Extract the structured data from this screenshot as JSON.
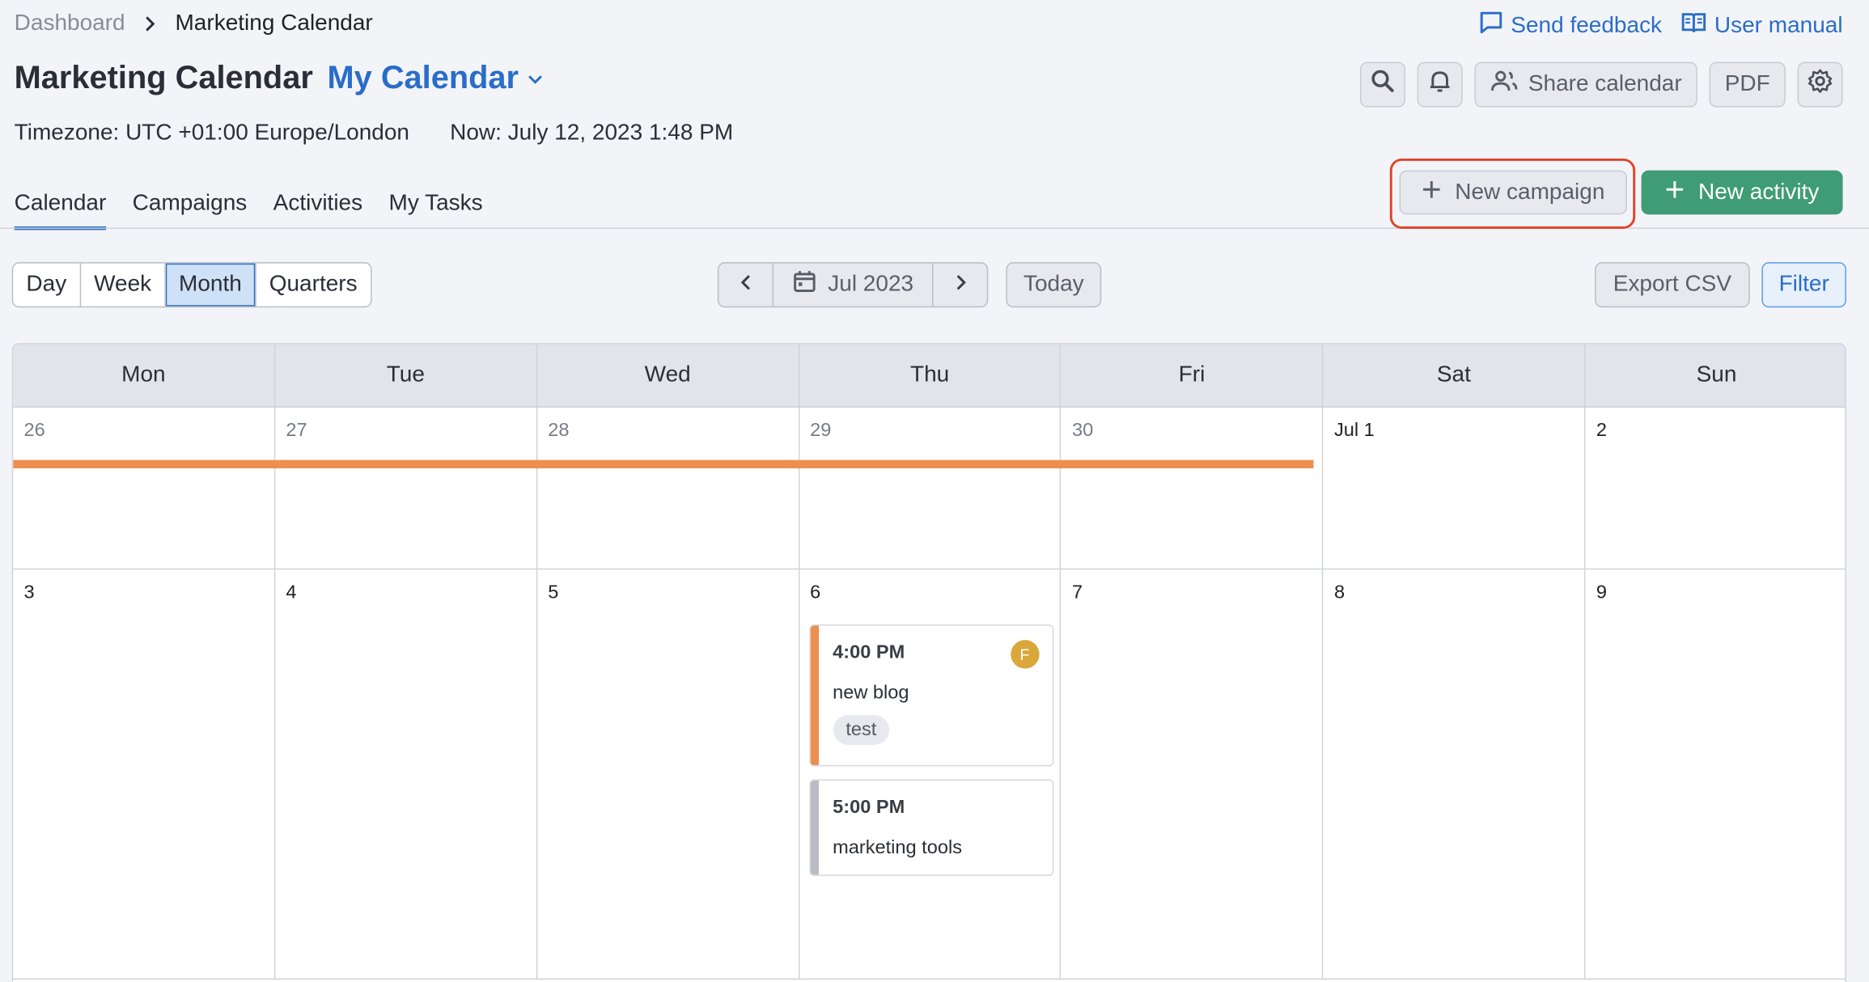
{
  "breadcrumb": {
    "home": "Dashboard",
    "current": "Marketing Calendar"
  },
  "header_links": {
    "feedback": "Send feedback",
    "manual": "User manual"
  },
  "page": {
    "title": "Marketing Calendar",
    "calendar_name": "My Calendar",
    "timezone": "Timezone: UTC +01:00 Europe/London",
    "now": "Now: July 12, 2023 1:48 PM"
  },
  "toolbar": {
    "share": "Share calendar",
    "pdf": "PDF"
  },
  "tabs": [
    "Calendar",
    "Campaigns",
    "Activities",
    "My Tasks"
  ],
  "actions": {
    "new_campaign": "New campaign",
    "new_activity": "New activity"
  },
  "views": [
    "Day",
    "Week",
    "Month",
    "Quarters"
  ],
  "active_view": "Month",
  "date_nav": {
    "current": "Jul 2023",
    "today": "Today"
  },
  "right_actions": {
    "export": "Export CSV",
    "filter": "Filter"
  },
  "weekdays": [
    "Mon",
    "Tue",
    "Wed",
    "Thu",
    "Fri",
    "Sat",
    "Sun"
  ],
  "weeks": [
    [
      "26",
      "27",
      "28",
      "29",
      "30",
      "Jul 1",
      "2"
    ],
    [
      "3",
      "4",
      "5",
      "6",
      "7",
      "8",
      "9"
    ]
  ],
  "events": [
    {
      "time": "4:00 PM",
      "name": "new blog",
      "tag": "test",
      "avatar": "F",
      "color": "#ee8e4f"
    },
    {
      "time": "5:00 PM",
      "name": "marketing tools",
      "color": "#b9bcc4"
    }
  ],
  "colors": {
    "accent": "#2a6dc9",
    "primary_button": "#3f9c74",
    "campaign": "#ee8e4f",
    "highlight": "#e0442c"
  }
}
